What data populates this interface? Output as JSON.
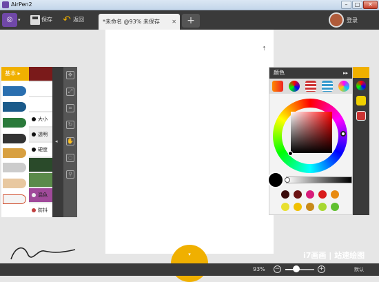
{
  "window": {
    "title": "AirPen2",
    "min": "–",
    "max": "□",
    "close": "✕"
  },
  "toolbar": {
    "menu_icon": "menu-logo-icon",
    "save_label": "保存",
    "back_label": "返回",
    "tab_label": "*未命名 @93% 未保存",
    "tab_close": "✕",
    "new_tab": "+",
    "login_label": "登录"
  },
  "tools": {
    "basic_label": "基本",
    "basic_arrow": "▸",
    "options": [
      {
        "label": "",
        "icon": "brush-icon"
      },
      {
        "label": "",
        "icon": "stroke-icon"
      },
      {
        "label": "",
        "icon": "texture-icon"
      },
      {
        "label": "大小",
        "icon": "size-dot"
      },
      {
        "label": "透明",
        "icon": "opacity-dot"
      },
      {
        "label": "硬度",
        "icon": "hardness-dot"
      },
      {
        "label": "",
        "icon": "splat-icon"
      },
      {
        "label": "",
        "icon": "scatter-icon"
      },
      {
        "label": "混色",
        "icon": "blend-dot"
      },
      {
        "label": "防抖",
        "icon": "stabilizer-icon"
      }
    ],
    "brushes": [
      "pen-nib-icon",
      "ink-pen-icon",
      "marker-icon",
      "pencil-icon",
      "airbrush-icon",
      "knife-icon",
      "eraser-icon",
      "crayon-icon"
    ],
    "transform": [
      "move-icon",
      "scale-icon",
      "crop-icon",
      "rotate-icon",
      "hand-icon",
      "lasso-icon",
      "eyedropper-icon"
    ],
    "collapse_arrow": "◂"
  },
  "color": {
    "header": "颜色",
    "collapse": "▸▸",
    "current": "#000000",
    "tabs": [
      "palette-icon",
      "color-wheel-icon",
      "sliders-icon",
      "slider-bars-icon",
      "swatch-icon"
    ],
    "swatches_row1": [
      "#3a0a0a",
      "#6b1212",
      "#d81b7a",
      "#d81b1b",
      "#e88a10"
    ],
    "swatches_row2": [
      "#e8e030",
      "#f0c000",
      "#c88a1a",
      "#a8d830",
      "#60c030"
    ]
  },
  "layers": {
    "icons": [
      "color-wheel-icon",
      "layers-icon",
      "image-icon"
    ]
  },
  "fab_arrow": "▾",
  "watermark": "i7画画 | 站速绘图",
  "status": {
    "zoom": "93%",
    "zoom_out": "−",
    "zoom_in": "+",
    "zoom_level": 0.3,
    "default_label": "默认"
  },
  "colors": {
    "accent": "#f0b000",
    "dark": "#3a3a3a",
    "brand": "#7048a8"
  }
}
